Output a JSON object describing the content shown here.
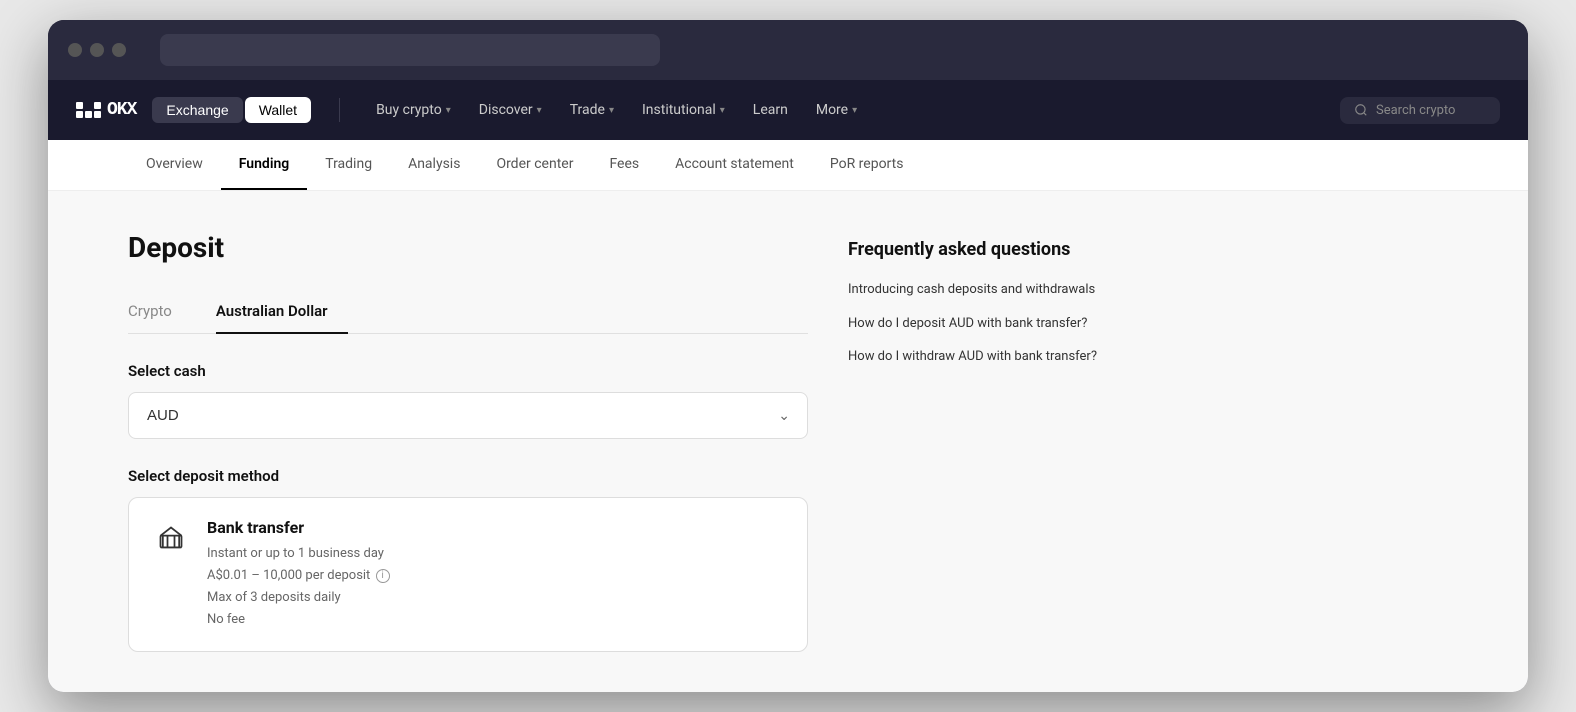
{
  "browser": {
    "address_bar_placeholder": ""
  },
  "navbar": {
    "logo_text": "OKX",
    "btn_exchange": "Exchange",
    "btn_wallet": "Wallet",
    "nav_items": [
      {
        "label": "Buy crypto",
        "has_chevron": true
      },
      {
        "label": "Discover",
        "has_chevron": true
      },
      {
        "label": "Trade",
        "has_chevron": true
      },
      {
        "label": "Institutional",
        "has_chevron": true
      },
      {
        "label": "Learn",
        "has_chevron": false
      },
      {
        "label": "More",
        "has_chevron": true
      }
    ],
    "search_placeholder": "Search crypto"
  },
  "subnav": {
    "items": [
      {
        "label": "Overview",
        "active": false
      },
      {
        "label": "Funding",
        "active": true
      },
      {
        "label": "Trading",
        "active": false
      },
      {
        "label": "Analysis",
        "active": false
      },
      {
        "label": "Order center",
        "active": false
      },
      {
        "label": "Fees",
        "active": false
      },
      {
        "label": "Account statement",
        "active": false
      },
      {
        "label": "PoR reports",
        "active": false
      }
    ]
  },
  "deposit": {
    "page_title": "Deposit",
    "tabs": [
      {
        "label": "Crypto",
        "active": false
      },
      {
        "label": "Australian Dollar",
        "active": true
      }
    ],
    "select_cash_label": "Select cash",
    "select_value": "AUD",
    "select_deposit_label": "Select deposit method",
    "method": {
      "title": "Bank transfer",
      "line1": "Instant or up to 1 business day",
      "line2": "A$0.01 – 10,000 per deposit",
      "line3": "Max of 3 deposits daily",
      "line4": "No fee"
    }
  },
  "faq": {
    "title": "Frequently asked questions",
    "items": [
      {
        "label": "Introducing cash deposits and withdrawals"
      },
      {
        "label": "How do I deposit AUD with bank transfer?"
      },
      {
        "label": "How do I withdraw AUD with bank transfer?"
      }
    ]
  }
}
